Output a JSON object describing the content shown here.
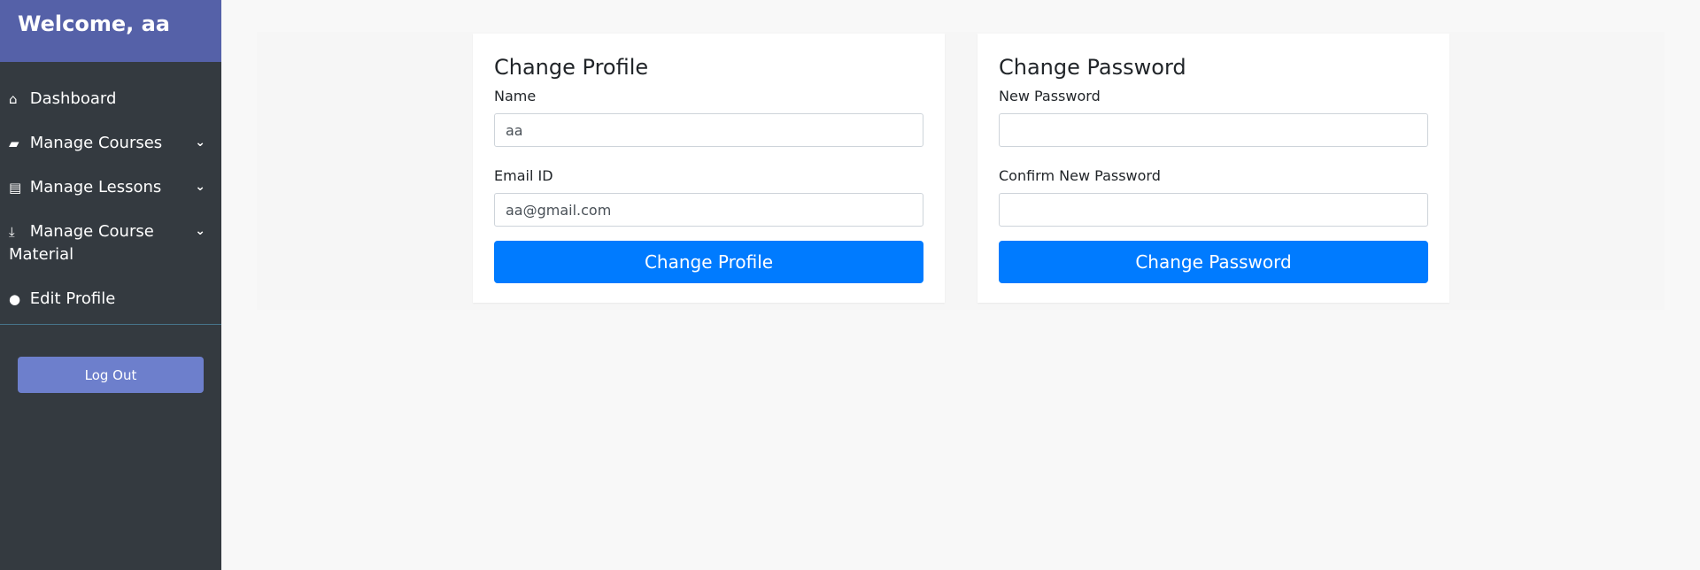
{
  "sidebar": {
    "welcome": "Welcome, aa",
    "items": [
      {
        "label": "Dashboard",
        "icon": "home-icon",
        "has_submenu": false
      },
      {
        "label": "Manage Courses",
        "icon": "book-icon",
        "has_submenu": true
      },
      {
        "label": "Manage Lessons",
        "icon": "file-icon",
        "has_submenu": true
      },
      {
        "label": "Manage Course Material",
        "icon": "download-icon",
        "has_submenu": true
      },
      {
        "label": "Edit Profile",
        "icon": "user-icon",
        "has_submenu": false
      }
    ],
    "logout_label": "Log Out"
  },
  "profile_card": {
    "title": "Change Profile",
    "name_label": "Name",
    "name_value": "aa",
    "email_label": "Email ID",
    "email_value": "aa@gmail.com",
    "button_label": "Change Profile"
  },
  "password_card": {
    "title": "Change Password",
    "new_label": "New Password",
    "new_value": "",
    "confirm_label": "Confirm New Password",
    "confirm_value": "",
    "button_label": "Change Password"
  },
  "colors": {
    "sidebar_bg": "#343a40",
    "header_bg": "#5561a8",
    "logout_bg": "#6d7fcc",
    "primary": "#007bff"
  }
}
